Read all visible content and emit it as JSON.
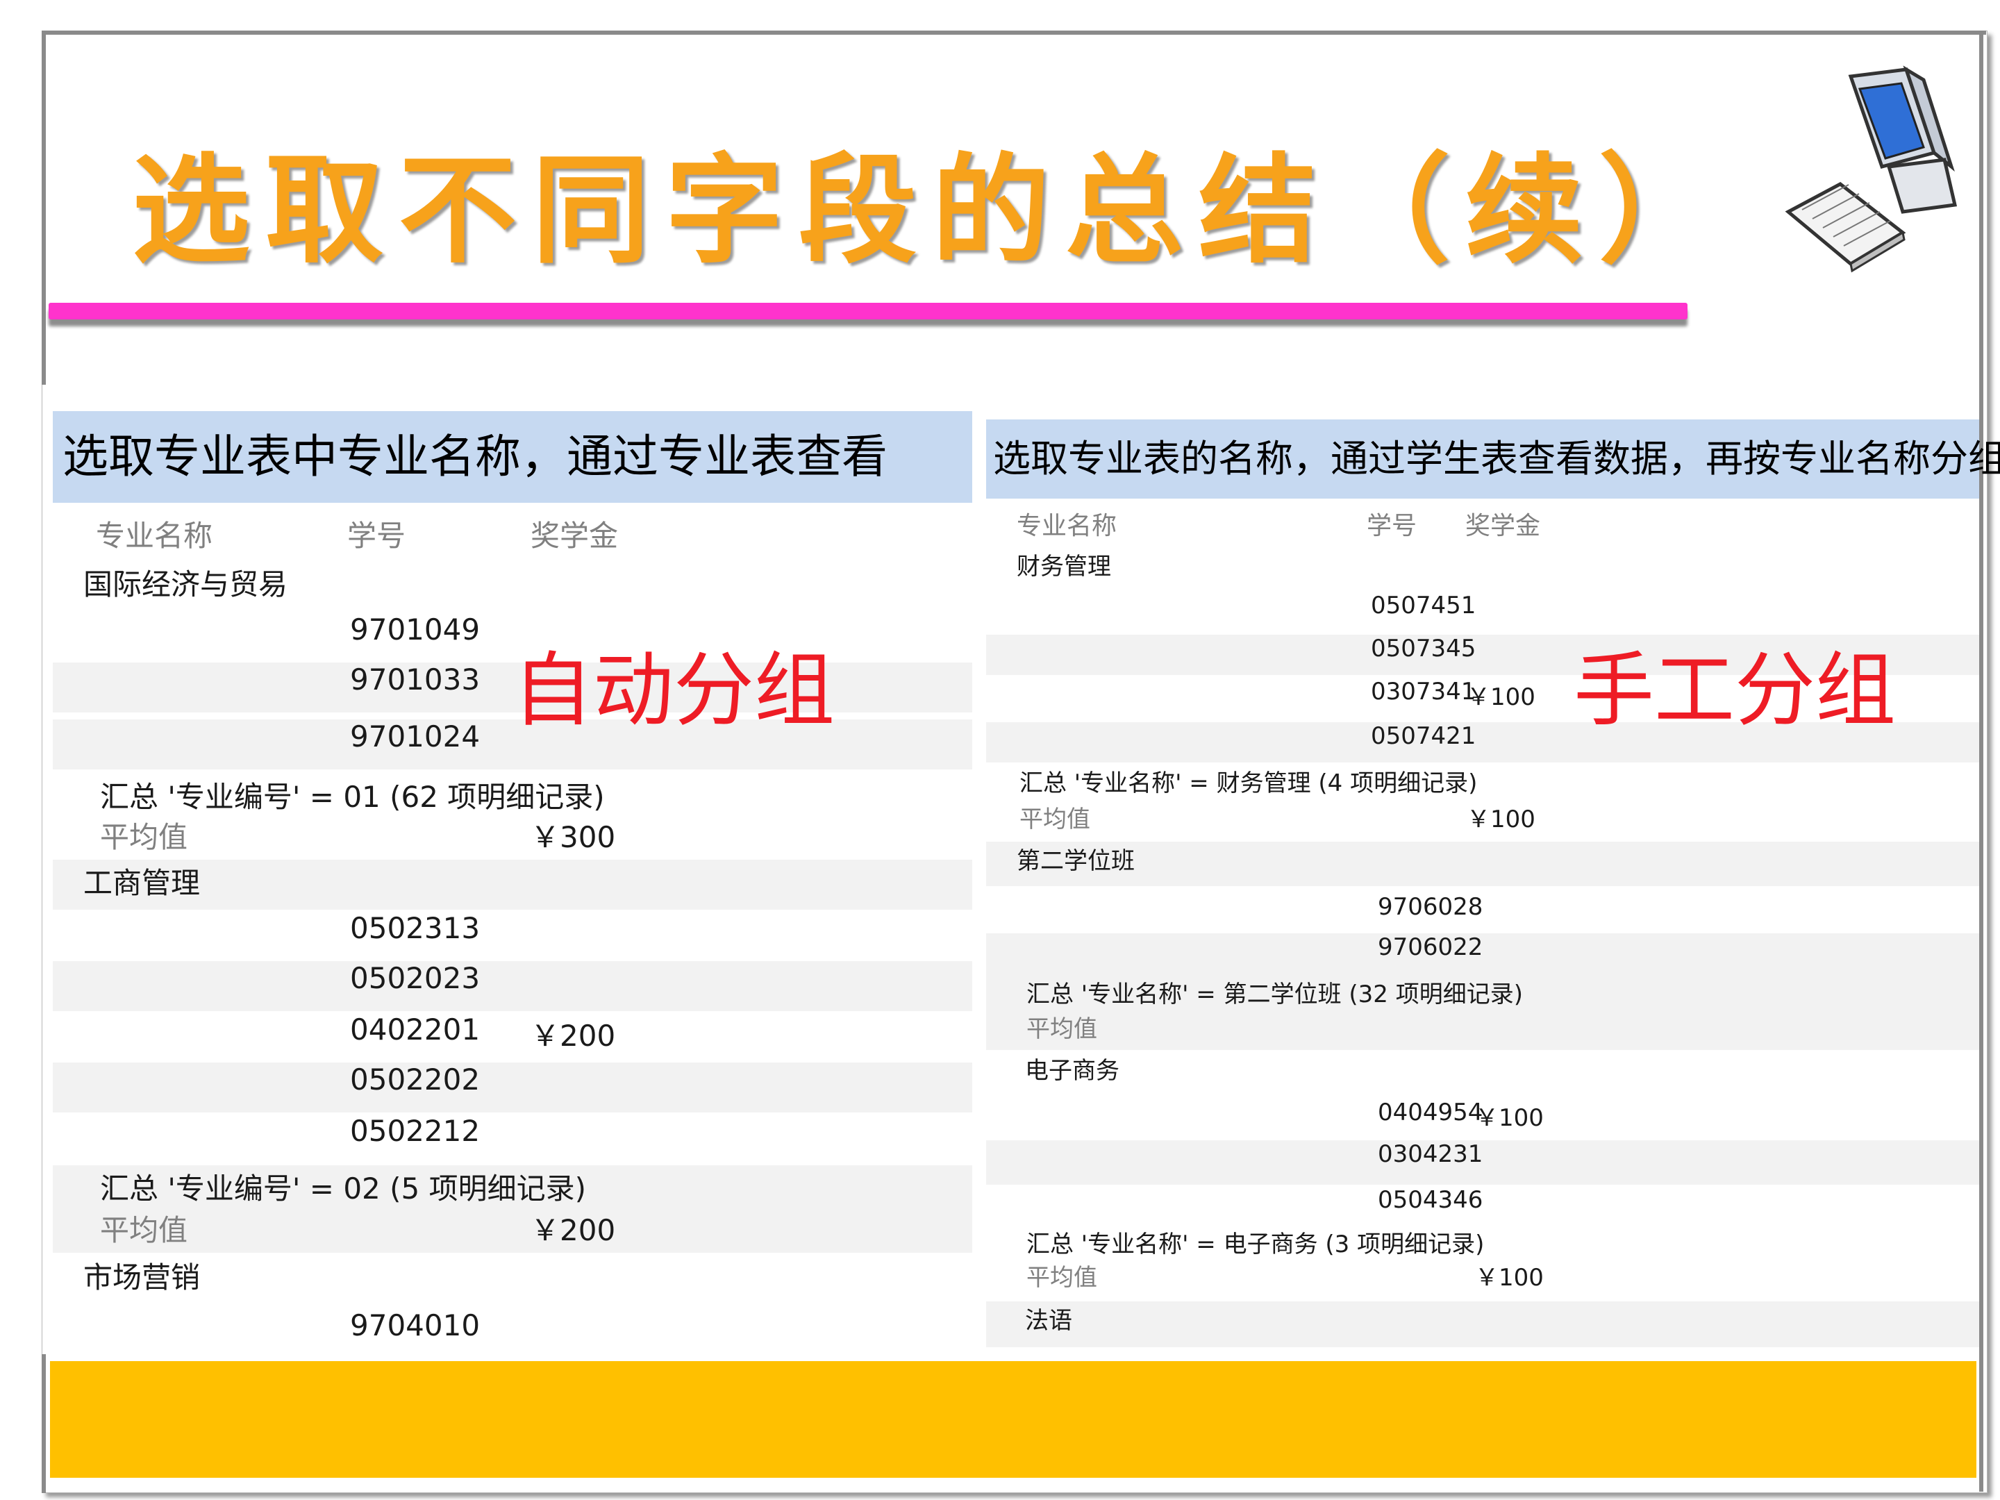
{
  "slide": {
    "title": "选取不同字段的总结（续）",
    "icon": "computer-icon",
    "accent_colors": {
      "title": "#f7a21b",
      "bar": "#ff33cc",
      "caption_bg": "#c6d9f1",
      "overlay": "#ee1c25",
      "footer": "#ffc000"
    }
  },
  "left": {
    "caption": "选取专业表中专业名称，通过专业表查看",
    "headers": [
      "专业名称",
      "学号",
      "奖学金"
    ],
    "overlay": "自动分组",
    "rows": [
      {
        "c1": "国际经济与贸易",
        "c2": "",
        "c3": ""
      },
      {
        "c1": "",
        "c2": "9701049",
        "c3": ""
      },
      {
        "c1": "",
        "c2": "9701033",
        "c3": ""
      },
      {
        "c1": "",
        "c2": "9701024",
        "c3": ""
      },
      {
        "c1": "汇总 '专业编号' =  01 (62 项明细记录)",
        "c2": "",
        "c3": ""
      },
      {
        "c1": "平均值",
        "c2": "",
        "c3": "￥300"
      },
      {
        "c1": "工商管理",
        "c2": "",
        "c3": ""
      },
      {
        "c1": "",
        "c2": "0502313",
        "c3": ""
      },
      {
        "c1": "",
        "c2": "0502023",
        "c3": ""
      },
      {
        "c1": "",
        "c2": "0402201",
        "c3": "￥200"
      },
      {
        "c1": "",
        "c2": "0502202",
        "c3": ""
      },
      {
        "c1": "",
        "c2": "0502212",
        "c3": ""
      },
      {
        "c1": "汇总 '专业编号' =  02 (5 项明细记录)",
        "c2": "",
        "c3": ""
      },
      {
        "c1": "平均值",
        "c2": "",
        "c3": "￥200"
      },
      {
        "c1": "市场营销",
        "c2": "",
        "c3": ""
      },
      {
        "c1": "",
        "c2": "9704010",
        "c3": ""
      }
    ]
  },
  "right": {
    "caption": "选取专业表的名称，通过学生表查看数据，再按专业名称分组",
    "headers": [
      "专业名称",
      "学号",
      "奖学金"
    ],
    "overlay": "手工分组",
    "rows": [
      {
        "c1": "财务管理",
        "c2": "",
        "c3": ""
      },
      {
        "c1": "",
        "c2": "0507451",
        "c3": ""
      },
      {
        "c1": "",
        "c2": "0507345",
        "c3": ""
      },
      {
        "c1": "",
        "c2": "0307341",
        "c3": "￥100"
      },
      {
        "c1": "",
        "c2": "0507421",
        "c3": ""
      },
      {
        "c1": "汇总 '专业名称' =  财务管理 (4 项明细记录)",
        "c2": "",
        "c3": ""
      },
      {
        "c1": "平均值",
        "c2": "",
        "c3": "￥100"
      },
      {
        "c1": "第二学位班",
        "c2": "",
        "c3": ""
      },
      {
        "c1": "",
        "c2": "9706028",
        "c3": ""
      },
      {
        "c1": "",
        "c2": "9706022",
        "c3": ""
      },
      {
        "c1": "汇总 '专业名称' =  第二学位班 (32 项明细记录)",
        "c2": "",
        "c3": ""
      },
      {
        "c1": "平均值",
        "c2": "",
        "c3": ""
      },
      {
        "c1": "电子商务",
        "c2": "",
        "c3": ""
      },
      {
        "c1": "",
        "c2": "0404954",
        "c3": "￥100"
      },
      {
        "c1": "",
        "c2": "0304231",
        "c3": ""
      },
      {
        "c1": "",
        "c2": "0504346",
        "c3": ""
      },
      {
        "c1": "汇总 '专业名称' =  电子商务 (3 项明细记录)",
        "c2": "",
        "c3": ""
      },
      {
        "c1": "平均值",
        "c2": "",
        "c3": "￥100"
      },
      {
        "c1": "法语",
        "c2": "",
        "c3": ""
      }
    ]
  }
}
